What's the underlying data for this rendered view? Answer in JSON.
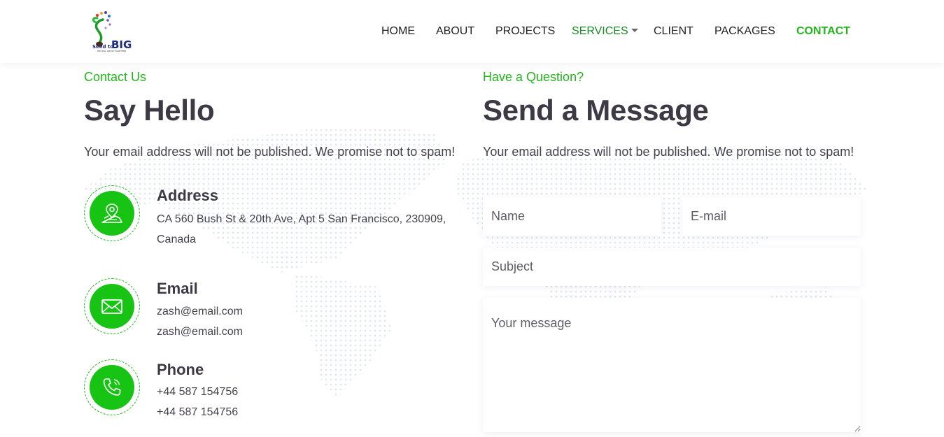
{
  "header": {
    "logo": {
      "text_main": "BIG",
      "text_small": "Seed to",
      "tagline": "WE WILL GROW TOGETHER"
    },
    "nav": [
      {
        "label": "HOME"
      },
      {
        "label": "ABOUT"
      },
      {
        "label": "PROJECTS"
      },
      {
        "label": "SERVICES",
        "dropdown": true
      },
      {
        "label": "CLIENT"
      },
      {
        "label": "PACKAGES"
      },
      {
        "label": "CONTACT",
        "active": true
      }
    ]
  },
  "contact": {
    "eyebrow": "Contact Us",
    "title": "Say Hello",
    "lead": "Your email address will not be published. We promise not to spam!",
    "items": [
      {
        "icon": "location-map-icon",
        "title": "Address",
        "lines": [
          "CA 560 Bush St & 20th Ave, Apt 5 San Francisco, 230909,",
          "Canada"
        ]
      },
      {
        "icon": "envelope-icon",
        "title": "Email",
        "lines": [
          "zash@email.com",
          "zash@email.com"
        ]
      },
      {
        "icon": "phone-icon",
        "title": "Phone",
        "lines": [
          "+44 587 154756",
          "+44 587 154756"
        ]
      }
    ]
  },
  "form": {
    "eyebrow": "Have a Question?",
    "title": "Send a Message",
    "lead": "Your email address will not be published. We promise not to spam!",
    "name_placeholder": "Name",
    "email_placeholder": "E-mail",
    "subject_placeholder": "Subject",
    "message_placeholder": "Your message"
  },
  "colors": {
    "accent": "#22b51c",
    "icon_bg": "#17c414",
    "heading": "#3d3a45"
  }
}
